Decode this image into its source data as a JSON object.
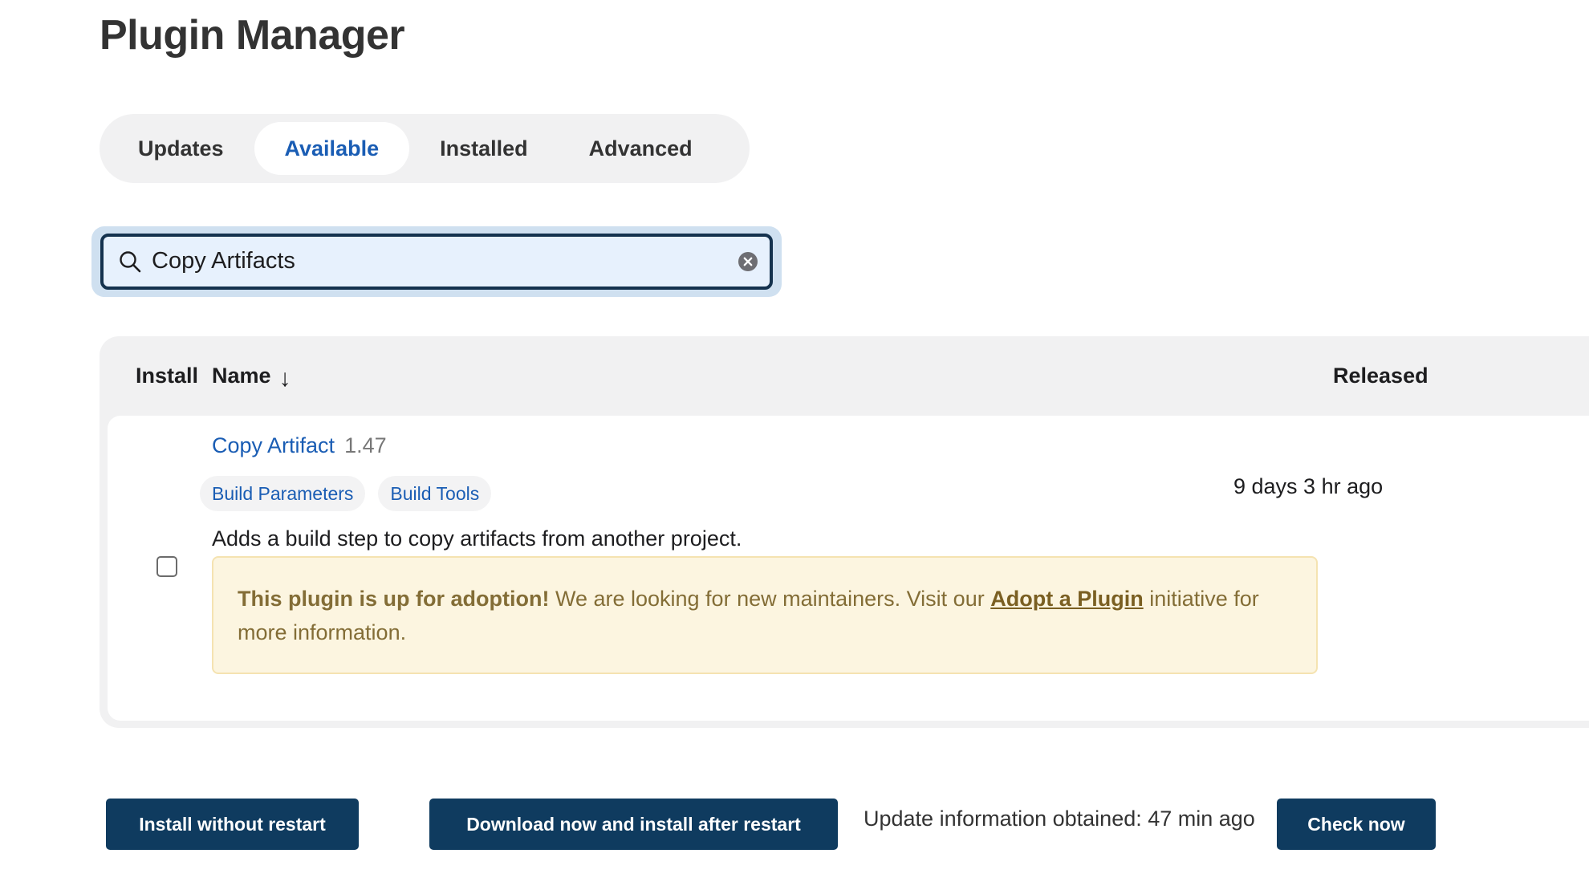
{
  "page": {
    "title": "Plugin Manager"
  },
  "tabs": [
    {
      "label": "Updates",
      "active": false
    },
    {
      "label": "Available",
      "active": true
    },
    {
      "label": "Installed",
      "active": false
    },
    {
      "label": "Advanced",
      "active": false
    }
  ],
  "search": {
    "value": "Copy Artifacts",
    "icon": "search-icon",
    "clear_icon": "clear-icon"
  },
  "table": {
    "headers": {
      "install": "Install",
      "name": "Name",
      "name_sort_arrow": "↓",
      "released": "Released"
    },
    "rows": [
      {
        "checked": false,
        "name": "Copy Artifact",
        "version": "1.47",
        "tags": [
          "Build Parameters",
          "Build Tools"
        ],
        "description": "Adds a build step to copy artifacts from another project.",
        "adoption": {
          "bold": "This plugin is up for adoption!",
          "text_before_link": " We are looking for new maintainers. Visit our ",
          "link": "Adopt a Plugin",
          "text_after_link": " initiative for more information."
        },
        "released": "9 days 3 hr ago"
      }
    ]
  },
  "footer": {
    "install_without_restart": "Install without restart",
    "download_and_install": "Download now and install after restart",
    "update_info": "Update information obtained: 47 min ago",
    "check_now": "Check now"
  },
  "colors": {
    "link_blue": "#1a5db4",
    "button_navy": "#0f3b5f",
    "adoption_bg": "#fcf5e0",
    "adoption_text": "#836d36"
  }
}
